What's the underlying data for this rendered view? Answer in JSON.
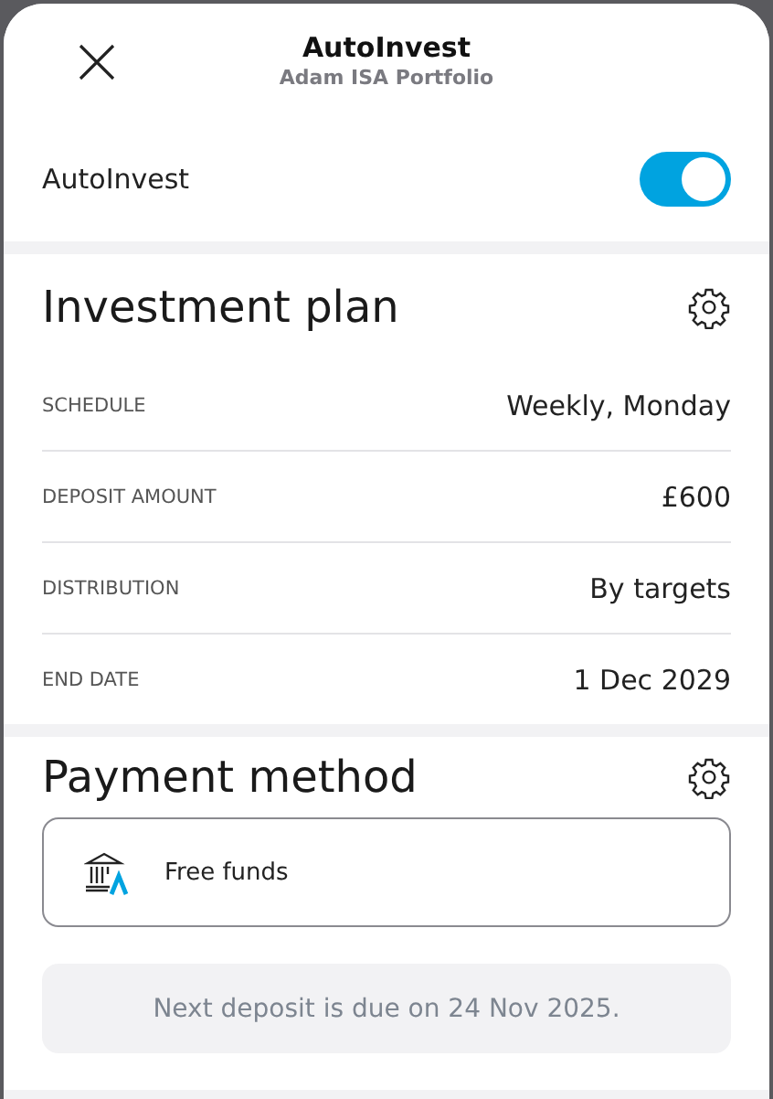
{
  "header": {
    "title": "AutoInvest",
    "subtitle": "Adam ISA Portfolio"
  },
  "autoinvest": {
    "label": "AutoInvest",
    "on": true
  },
  "investment_plan": {
    "title": "Investment plan",
    "rows": [
      {
        "label": "SCHEDULE",
        "value": "Weekly, Monday"
      },
      {
        "label": "DEPOSIT AMOUNT",
        "value": "£600"
      },
      {
        "label": "DISTRIBUTION",
        "value": "By targets"
      },
      {
        "label": "END DATE",
        "value": "1 Dec 2029"
      }
    ]
  },
  "payment_method": {
    "title": "Payment method",
    "option": "Free funds",
    "notice": "Next deposit is due on 24 Nov 2025."
  }
}
